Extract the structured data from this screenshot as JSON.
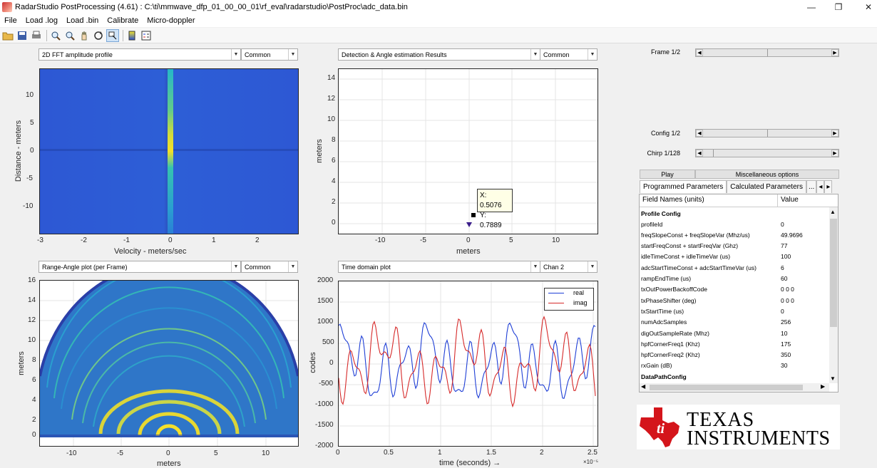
{
  "window": {
    "title": "RadarStudio PostProcessing (4.61)  : C:\\ti\\mmwave_dfp_01_00_00_01\\rf_eval\\radarstudio\\PostProc\\adc_data.bin"
  },
  "menu": [
    "File",
    "Load .log",
    "Load .bin",
    "Calibrate",
    "Micro-doppler"
  ],
  "toolbar_icons": [
    "open-icon",
    "save-icon",
    "print-icon",
    "zoom-in-icon",
    "zoom-out-icon",
    "pan-icon",
    "rotate-icon",
    "data-cursor-icon",
    "colorbar-icon",
    "legend-icon"
  ],
  "plot1": {
    "dropdown": "2D FFT amplitude profile",
    "mode": "Common",
    "xlabel": "Velocity - meters/sec",
    "ylabel": "Distance - meters",
    "xticks": [
      "-3",
      "-2",
      "-1",
      "0",
      "1",
      "2"
    ],
    "yticks": [
      "10",
      "5",
      "0",
      "-5",
      "-10"
    ]
  },
  "plot2": {
    "dropdown": "Detection & Angle estimation Results",
    "mode": "Common",
    "xlabel": "meters",
    "ylabel": "meters",
    "xticks": [
      "-10",
      "-5",
      "0",
      "5",
      "10"
    ],
    "yticks": [
      "14",
      "12",
      "10",
      "8",
      "6",
      "4",
      "2",
      "0"
    ],
    "datatip_x": "X: 0.5076",
    "datatip_y": "Y: 0.7889"
  },
  "plot3": {
    "dropdown": "Range-Angle plot (per Frame)",
    "mode": "Common",
    "xlabel": "meters",
    "ylabel": "meters",
    "xticks": [
      "-10",
      "-5",
      "0",
      "5",
      "10"
    ],
    "yticks": [
      "16",
      "14",
      "12",
      "10",
      "8",
      "6",
      "4",
      "2",
      "0"
    ]
  },
  "plot4": {
    "dropdown": "Time domain plot",
    "mode": "Chan 2",
    "xlabel": "time  (seconds) →",
    "ylabel": "codes",
    "xticks": [
      "0",
      "0.5",
      "1",
      "1.5",
      "2",
      "2.5"
    ],
    "yticks": [
      "2000",
      "1500",
      "1000",
      "500",
      "0",
      "-500",
      "-1000",
      "-1500",
      "-2000"
    ],
    "exponent": "×10⁻⁵",
    "legend": [
      "real",
      "imag"
    ]
  },
  "colors": {
    "real": "#1f3fd6",
    "imag": "#d62a2a",
    "heat_low": "#2a4fd0",
    "heat_high": "#f5e62a"
  },
  "controls": {
    "frame": "Frame 1/2",
    "config": "Config 1/2",
    "chirp": "Chirp 1/128",
    "play": "Play",
    "misc": "Miscellaneous options"
  },
  "tabs": [
    "Programmed Parameters",
    "Calculated Parameters",
    "..."
  ],
  "table": {
    "headers": [
      "Field Names    (units)",
      "Value"
    ],
    "section1": "Profile Config",
    "rows": [
      [
        "profileId",
        "0"
      ],
      [
        "freqSlopeConst + freqSlopeVar (Mhz/us)",
        "49.9696"
      ],
      [
        "startFreqConst + startFreqVar (Ghz)",
        "77"
      ],
      [
        "idleTimeConst + idleTimeVar (us)",
        "100"
      ],
      [
        "adcStartTimeConst + adcStartTimeVar (us)",
        "6"
      ],
      [
        "rampEndTime (us)",
        "60"
      ],
      [
        "txOutPowerBackoffCode",
        "0 0 0"
      ],
      [
        "txPhaseShifter (deg)",
        "0 0 0"
      ],
      [
        "txStartTime (us)",
        "0"
      ],
      [
        "numAdcSamples",
        "256"
      ],
      [
        "digOutSampleRate (Mhz)",
        "10"
      ],
      [
        "hpfCornerFreq1 (Khz)",
        "175"
      ],
      [
        "hpfCornerFreq2 (Khz)",
        "350"
      ],
      [
        "rxGain (dB)",
        "30"
      ]
    ],
    "section2": "DataPathConfig"
  },
  "logo": {
    "line1": "TEXAS",
    "line2": "INSTRUMENTS"
  }
}
